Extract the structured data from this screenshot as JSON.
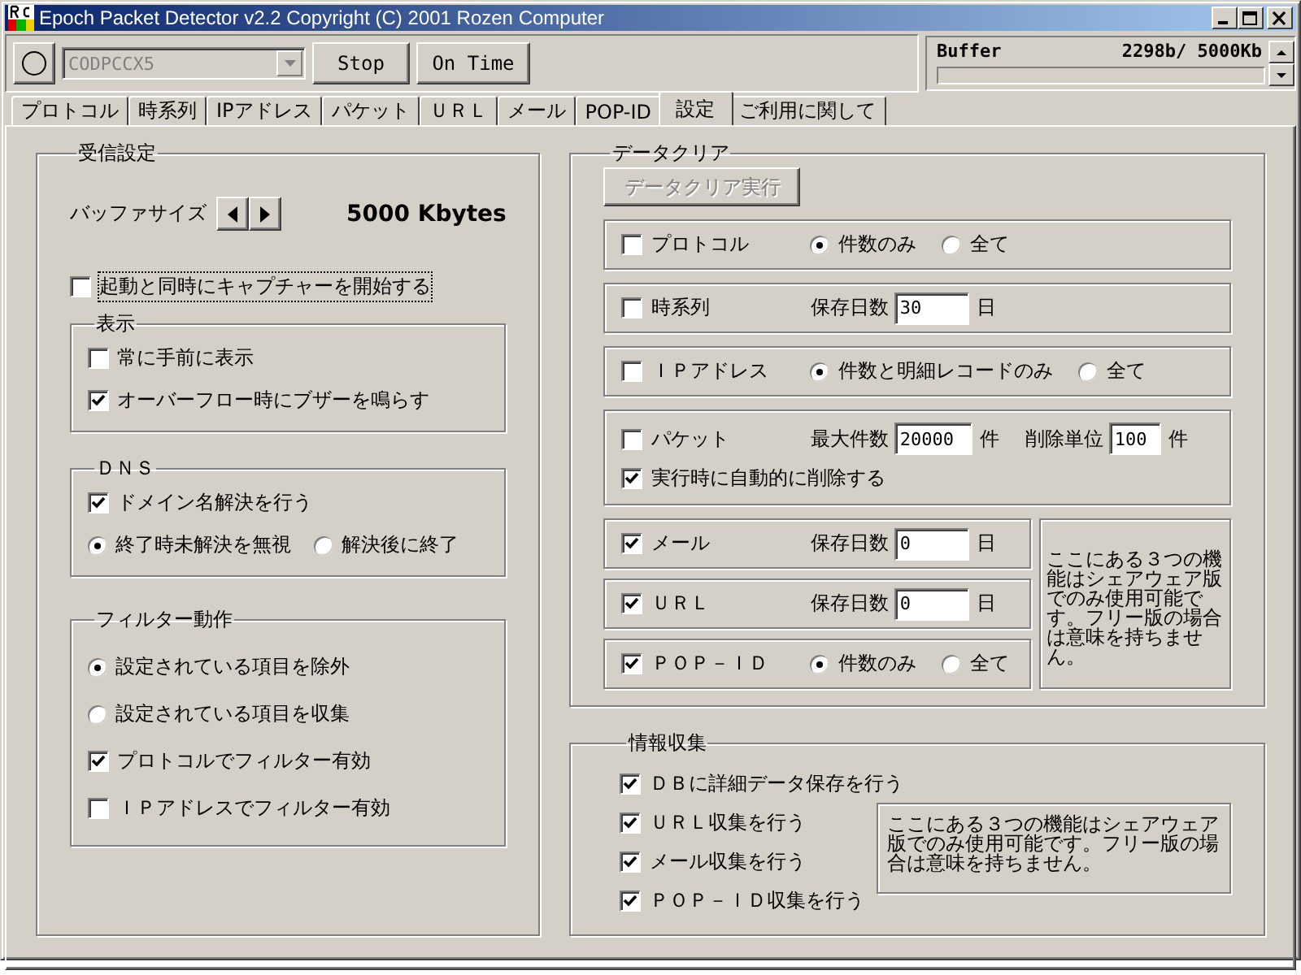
{
  "window": {
    "title": "Epoch Packet Detector v2.2  Copyright (C) 2001 Rozen Computer"
  },
  "toolbar": {
    "combo": {
      "value": "CODPCCX5",
      "disabled": true
    },
    "buttons": [
      "Stop",
      "On Time"
    ],
    "buffer": {
      "label": "Buffer",
      "reading": "2298b/ 5000Kb"
    }
  },
  "tabs": [
    {
      "label": "プロトコル",
      "selected": false
    },
    {
      "label": "時系列",
      "selected": false
    },
    {
      "label": "IPアドレス",
      "selected": false
    },
    {
      "label": "パケット",
      "selected": false
    },
    {
      "label": "ＵＲＬ",
      "selected": false
    },
    {
      "label": "メール",
      "selected": false
    },
    {
      "label": "POP-ID",
      "selected": false
    },
    {
      "label": "設定",
      "selected": true
    },
    {
      "label": "ご利用に関して",
      "selected": false
    }
  ],
  "receive": {
    "title": "受信設定",
    "buffer_size": {
      "label": "バッファサイズ",
      "value": "5000 Kbytes"
    },
    "start_capture": {
      "label": "起動と同時にキャプチャーを開始する",
      "checked": false
    },
    "display": {
      "title": "表示",
      "options": [
        {
          "label": "常に手前に表示",
          "checked": false
        },
        {
          "label": "オーバーフロー時にブザーを鳴らす",
          "checked": true
        }
      ]
    },
    "dns": {
      "title": "ＤＮＳ",
      "resolve": {
        "label": "ドメイン名解決を行う",
        "checked": true
      },
      "radios": [
        {
          "label": "終了時未解決を無視",
          "selected": true
        },
        {
          "label": "解決後に終了",
          "selected": false
        }
      ]
    },
    "filter": {
      "title": "フィルター動作",
      "items": [
        {
          "kind": "radio",
          "label": "設定されている項目を除外",
          "selected": true
        },
        {
          "kind": "radio",
          "label": "設定されている項目を収集",
          "selected": false
        },
        {
          "kind": "checkbox",
          "label": "プロトコルでフィルター有効",
          "checked": true
        },
        {
          "kind": "checkbox",
          "label": "ＩＰアドレスでフィルター有効",
          "checked": false
        }
      ]
    }
  },
  "data_clear": {
    "title": "データクリア",
    "run_button": {
      "label": "データクリア実行",
      "disabled": true
    },
    "rows": [
      {
        "label": "プロトコル",
        "checked": false,
        "controls": [
          {
            "kind": "radio",
            "label": "件数のみ",
            "selected": true
          },
          {
            "kind": "radio",
            "label": "全て",
            "selected": false
          }
        ]
      },
      {
        "label": "時系列",
        "checked": false,
        "controls": [
          {
            "kind": "field",
            "label": "保存日数",
            "value": "30",
            "unit": "日"
          }
        ]
      },
      {
        "label": "ＩＰアドレス",
        "checked": false,
        "controls": [
          {
            "kind": "radio",
            "label": "件数と明細レコードのみ",
            "selected": true
          },
          {
            "kind": "radio",
            "label": "全て",
            "selected": false
          }
        ]
      },
      {
        "label": "パケット",
        "checked": false,
        "controls": [
          {
            "kind": "field",
            "label": "最大件数",
            "value": "20000",
            "unit": "件"
          },
          {
            "kind": "field",
            "label": "削除単位",
            "value": "100",
            "unit": "件"
          }
        ],
        "sub_option": {
          "label": "実行時に自動的に削除する",
          "checked": true
        }
      }
    ],
    "shareware_rows": [
      {
        "label": "メール",
        "checked": true,
        "controls": [
          {
            "kind": "field",
            "label": "保存日数",
            "value": "0",
            "unit": "日"
          }
        ]
      },
      {
        "label": "ＵＲＬ",
        "checked": true,
        "controls": [
          {
            "kind": "field",
            "label": "保存日数",
            "value": "0",
            "unit": "日"
          }
        ]
      },
      {
        "label": "ＰＯＰ－ＩＤ",
        "checked": true,
        "controls": [
          {
            "kind": "radio",
            "label": "件数のみ",
            "selected": true
          },
          {
            "kind": "radio",
            "label": "全て",
            "selected": false
          }
        ]
      }
    ],
    "note": "ここにある３つの機能はシェアウェア版でのみ使用可能です。フリー版の場合は意味を持ちません。"
  },
  "info": {
    "title": "情報収集",
    "options": [
      {
        "label": "ＤＢに詳細データ保存を行う",
        "checked": true
      },
      {
        "label": "ＵＲＬ収集を行う",
        "checked": true
      },
      {
        "label": "メール収集を行う",
        "checked": true
      },
      {
        "label": "ＰＯＰ－ＩＤ収集を行う",
        "checked": true
      }
    ],
    "note": "ここにある３つの機能はシェアウェア版でのみ使用可能です。フリー版の場合は意味を持ちません。"
  }
}
